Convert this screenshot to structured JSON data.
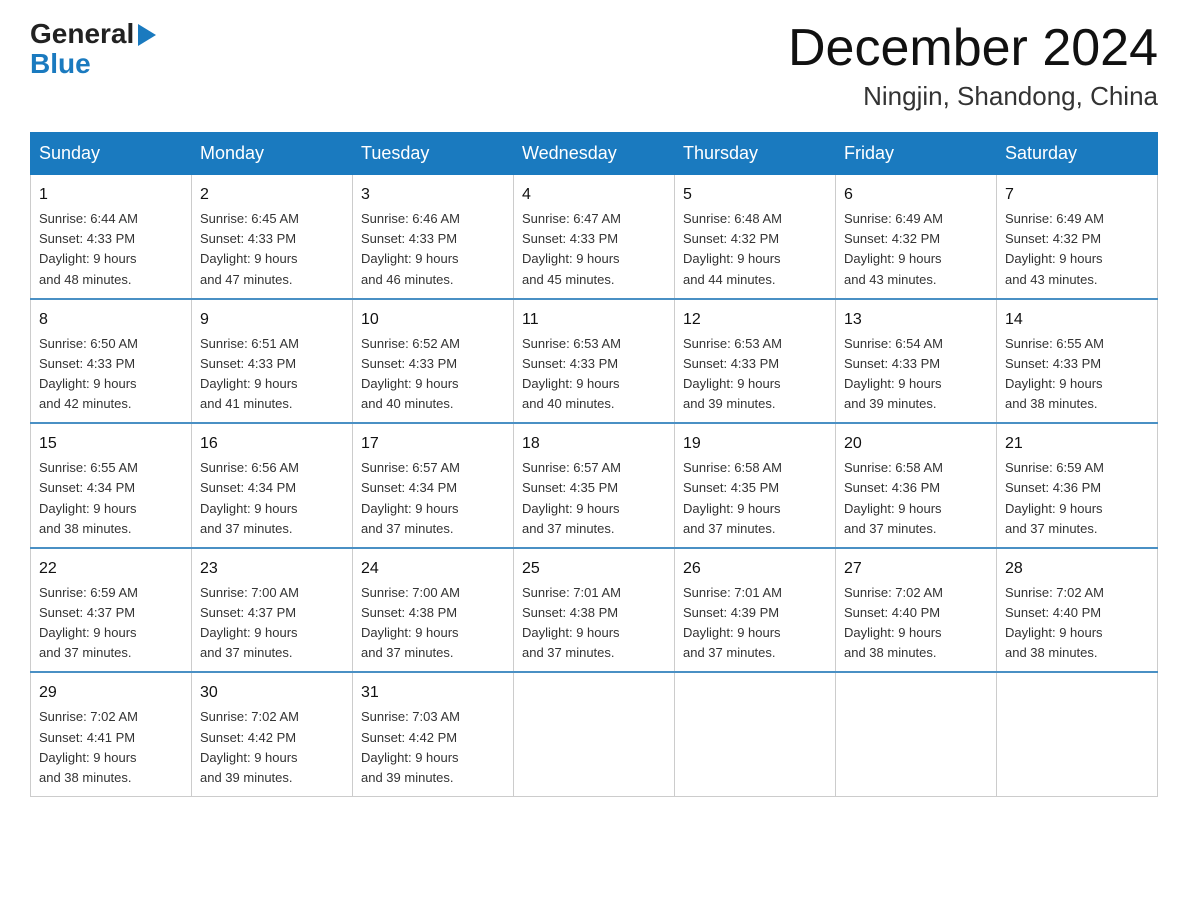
{
  "header": {
    "logo_general": "General",
    "logo_blue": "Blue",
    "month_title": "December 2024",
    "location": "Ningjin, Shandong, China"
  },
  "weekdays": [
    "Sunday",
    "Monday",
    "Tuesday",
    "Wednesday",
    "Thursday",
    "Friday",
    "Saturday"
  ],
  "weeks": [
    [
      {
        "day": "1",
        "sunrise": "6:44 AM",
        "sunset": "4:33 PM",
        "daylight": "9 hours and 48 minutes."
      },
      {
        "day": "2",
        "sunrise": "6:45 AM",
        "sunset": "4:33 PM",
        "daylight": "9 hours and 47 minutes."
      },
      {
        "day": "3",
        "sunrise": "6:46 AM",
        "sunset": "4:33 PM",
        "daylight": "9 hours and 46 minutes."
      },
      {
        "day": "4",
        "sunrise": "6:47 AM",
        "sunset": "4:33 PM",
        "daylight": "9 hours and 45 minutes."
      },
      {
        "day": "5",
        "sunrise": "6:48 AM",
        "sunset": "4:32 PM",
        "daylight": "9 hours and 44 minutes."
      },
      {
        "day": "6",
        "sunrise": "6:49 AM",
        "sunset": "4:32 PM",
        "daylight": "9 hours and 43 minutes."
      },
      {
        "day": "7",
        "sunrise": "6:49 AM",
        "sunset": "4:32 PM",
        "daylight": "9 hours and 43 minutes."
      }
    ],
    [
      {
        "day": "8",
        "sunrise": "6:50 AM",
        "sunset": "4:33 PM",
        "daylight": "9 hours and 42 minutes."
      },
      {
        "day": "9",
        "sunrise": "6:51 AM",
        "sunset": "4:33 PM",
        "daylight": "9 hours and 41 minutes."
      },
      {
        "day": "10",
        "sunrise": "6:52 AM",
        "sunset": "4:33 PM",
        "daylight": "9 hours and 40 minutes."
      },
      {
        "day": "11",
        "sunrise": "6:53 AM",
        "sunset": "4:33 PM",
        "daylight": "9 hours and 40 minutes."
      },
      {
        "day": "12",
        "sunrise": "6:53 AM",
        "sunset": "4:33 PM",
        "daylight": "9 hours and 39 minutes."
      },
      {
        "day": "13",
        "sunrise": "6:54 AM",
        "sunset": "4:33 PM",
        "daylight": "9 hours and 39 minutes."
      },
      {
        "day": "14",
        "sunrise": "6:55 AM",
        "sunset": "4:33 PM",
        "daylight": "9 hours and 38 minutes."
      }
    ],
    [
      {
        "day": "15",
        "sunrise": "6:55 AM",
        "sunset": "4:34 PM",
        "daylight": "9 hours and 38 minutes."
      },
      {
        "day": "16",
        "sunrise": "6:56 AM",
        "sunset": "4:34 PM",
        "daylight": "9 hours and 37 minutes."
      },
      {
        "day": "17",
        "sunrise": "6:57 AM",
        "sunset": "4:34 PM",
        "daylight": "9 hours and 37 minutes."
      },
      {
        "day": "18",
        "sunrise": "6:57 AM",
        "sunset": "4:35 PM",
        "daylight": "9 hours and 37 minutes."
      },
      {
        "day": "19",
        "sunrise": "6:58 AM",
        "sunset": "4:35 PM",
        "daylight": "9 hours and 37 minutes."
      },
      {
        "day": "20",
        "sunrise": "6:58 AM",
        "sunset": "4:36 PM",
        "daylight": "9 hours and 37 minutes."
      },
      {
        "day": "21",
        "sunrise": "6:59 AM",
        "sunset": "4:36 PM",
        "daylight": "9 hours and 37 minutes."
      }
    ],
    [
      {
        "day": "22",
        "sunrise": "6:59 AM",
        "sunset": "4:37 PM",
        "daylight": "9 hours and 37 minutes."
      },
      {
        "day": "23",
        "sunrise": "7:00 AM",
        "sunset": "4:37 PM",
        "daylight": "9 hours and 37 minutes."
      },
      {
        "day": "24",
        "sunrise": "7:00 AM",
        "sunset": "4:38 PM",
        "daylight": "9 hours and 37 minutes."
      },
      {
        "day": "25",
        "sunrise": "7:01 AM",
        "sunset": "4:38 PM",
        "daylight": "9 hours and 37 minutes."
      },
      {
        "day": "26",
        "sunrise": "7:01 AM",
        "sunset": "4:39 PM",
        "daylight": "9 hours and 37 minutes."
      },
      {
        "day": "27",
        "sunrise": "7:02 AM",
        "sunset": "4:40 PM",
        "daylight": "9 hours and 38 minutes."
      },
      {
        "day": "28",
        "sunrise": "7:02 AM",
        "sunset": "4:40 PM",
        "daylight": "9 hours and 38 minutes."
      }
    ],
    [
      {
        "day": "29",
        "sunrise": "7:02 AM",
        "sunset": "4:41 PM",
        "daylight": "9 hours and 38 minutes."
      },
      {
        "day": "30",
        "sunrise": "7:02 AM",
        "sunset": "4:42 PM",
        "daylight": "9 hours and 39 minutes."
      },
      {
        "day": "31",
        "sunrise": "7:03 AM",
        "sunset": "4:42 PM",
        "daylight": "9 hours and 39 minutes."
      },
      null,
      null,
      null,
      null
    ]
  ]
}
